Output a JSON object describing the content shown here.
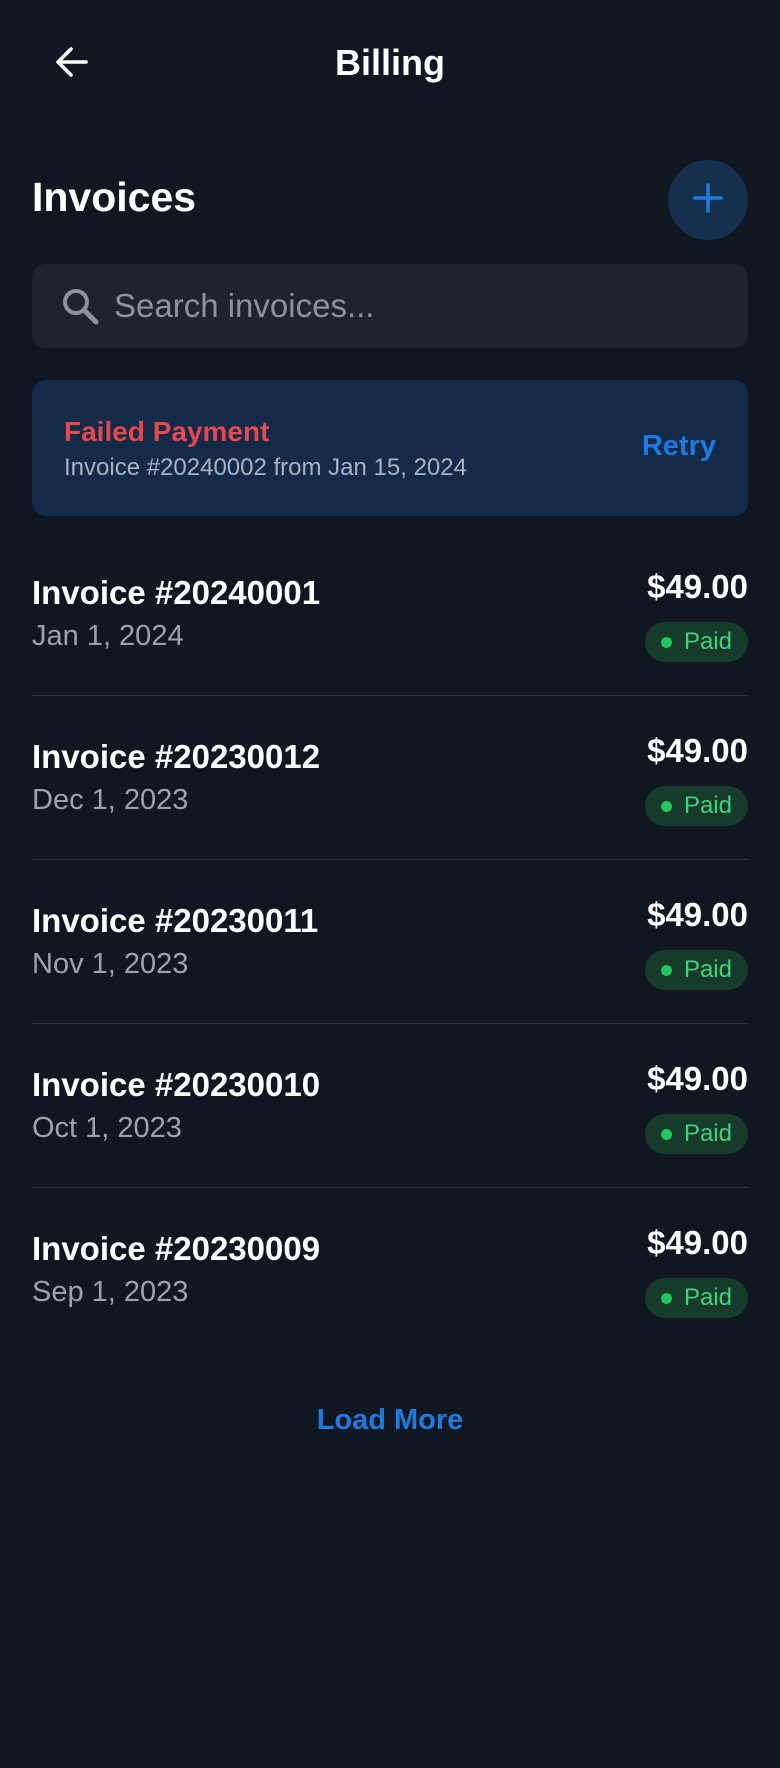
{
  "header": {
    "title": "Billing",
    "back_icon": "arrow-left-icon"
  },
  "section": {
    "title": "Invoices",
    "add_icon": "plus-icon"
  },
  "search": {
    "placeholder": "Search invoices...",
    "value": "",
    "icon": "search-icon"
  },
  "alert": {
    "title": "Failed Payment",
    "message": "Invoice #20240002 from Jan 15, 2024",
    "action_label": "Retry"
  },
  "invoices": [
    {
      "number": "Invoice #20240001",
      "date": "Jan 1, 2024",
      "amount": "$49.00",
      "status": "Paid"
    },
    {
      "number": "Invoice #20230012",
      "date": "Dec 1, 2023",
      "amount": "$49.00",
      "status": "Paid"
    },
    {
      "number": "Invoice #20230011",
      "date": "Nov 1, 2023",
      "amount": "$49.00",
      "status": "Paid"
    },
    {
      "number": "Invoice #20230010",
      "date": "Oct 1, 2023",
      "amount": "$49.00",
      "status": "Paid"
    },
    {
      "number": "Invoice #20230009",
      "date": "Sep 1, 2023",
      "amount": "$49.00",
      "status": "Paid"
    }
  ],
  "load_more_label": "Load More",
  "colors": {
    "background": "#111721",
    "accent": "#1f7adf",
    "error": "#e5484d",
    "success": "#22c55e",
    "alert_bg": "#132a48",
    "badge_bg": "#163b2a"
  }
}
